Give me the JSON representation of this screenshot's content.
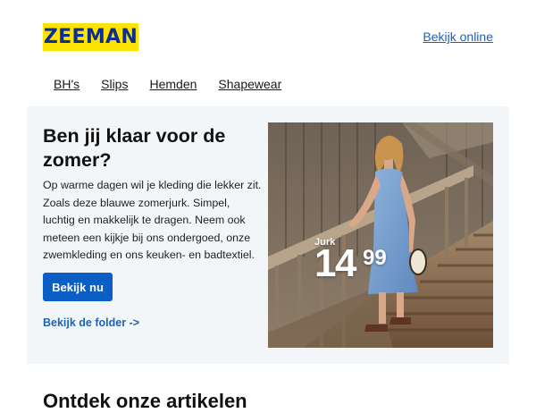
{
  "header": {
    "logo_text": "ZEEMAN",
    "view_online_label": "Bekijk online"
  },
  "nav": {
    "items": [
      "BH's",
      "Slips",
      "Hemden",
      "Shapewear"
    ]
  },
  "hero": {
    "headline": "Ben jij klaar voor de zomer?",
    "body": "Op warme dagen wil je kleding die lekker zit. Zoals deze blauwe zomerjurk. Simpel, luchtig en makkelijk te dragen. Neem ook meteen een kijkje bij ons ondergoed, onze zwemkleding en ons keuken- en badtextiel.",
    "cta_label": "Bekijk nu",
    "folder_link_label": "Bekijk de folder ->",
    "price_label": "Jurk",
    "price_main": "14",
    "price_cents": "99"
  },
  "next_section": {
    "heading": "Ontdek onze artikelen"
  },
  "colors": {
    "brand_yellow": "#ffe300",
    "brand_blue": "#0a2f8c",
    "accent_blue": "#0a5ec4",
    "link_blue": "#1e63b5",
    "card_bg": "#f3f6f9"
  }
}
